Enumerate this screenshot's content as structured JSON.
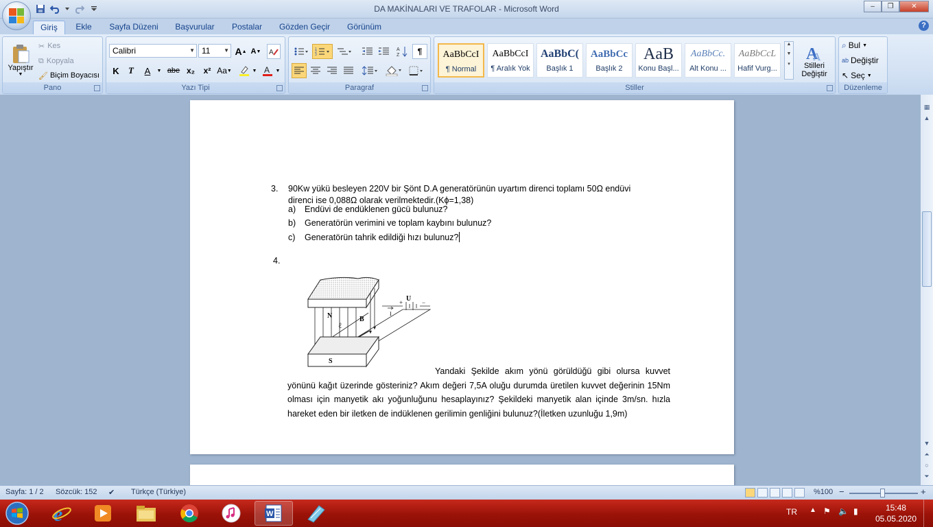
{
  "window": {
    "title": "DA MAKİNALARI VE TRAFOLAR - Microsoft Word",
    "controls": {
      "minimize": "–",
      "maximize": "❐",
      "close": "✕"
    }
  },
  "tabs": [
    "Giriş",
    "Ekle",
    "Sayfa Düzeni",
    "Başvurular",
    "Postalar",
    "Gözden Geçir",
    "Görünüm"
  ],
  "ribbon": {
    "clipboard": {
      "label": "Pano",
      "paste": "Yapıştır",
      "cut": "Kes",
      "copy": "Kopyala",
      "format_painter": "Biçim Boyacısı"
    },
    "font": {
      "label": "Yazı Tipi",
      "family": "Calibri",
      "size": "11",
      "bold": "K",
      "italic": "T",
      "underline": "A",
      "strike": "abe",
      "subscript": "x₂",
      "superscript": "x²",
      "change_case": "Aa",
      "grow": "A",
      "shrink": "A"
    },
    "paragraph": {
      "label": "Paragraf",
      "pilcrow": "¶"
    },
    "styles": {
      "label": "Stiller",
      "items": [
        {
          "sample": "AaBbCcI",
          "name": "¶ Normal"
        },
        {
          "sample": "AaBbCcI",
          "name": "¶ Aralık Yok"
        },
        {
          "sample": "AaBbC(",
          "name": "Başlık 1"
        },
        {
          "sample": "AaBbCc",
          "name": "Başlık 2"
        },
        {
          "sample": "AaB",
          "name": "Konu Başl..."
        },
        {
          "sample": "AaBbCc.",
          "name": "Alt Konu ..."
        },
        {
          "sample": "AaBbCcL",
          "name": "Hafif Vurg..."
        }
      ],
      "change_styles_line1": "Stilleri",
      "change_styles_line2": "Değiştir"
    },
    "editing": {
      "label": "Düzenleme",
      "find": "Bul",
      "replace": "Değiştir",
      "select": "Seç"
    }
  },
  "document": {
    "q3": {
      "number": "3.",
      "line1": "90Kw yükü besleyen 220V bir Şönt D.A generatörünün uyartım direnci toplamı 50Ω endüvi",
      "line2": "direnci ise 0,088Ω olarak verilmektedir.(Kϕ=1,38)",
      "items": [
        {
          "mark": "a)",
          "text": "Endüvi de endüklenen gücü bulunuz?"
        },
        {
          "mark": "b)",
          "text": "Generatörün verimini ve toplam kaybını bulunuz?"
        },
        {
          "mark": "c)",
          "text": "Generatörün tahrik edildiği hızı bulunuz?"
        }
      ]
    },
    "q4": {
      "number": "4.",
      "figure_labels": {
        "n": "N",
        "s": "S",
        "b": "B",
        "l": "ℓ",
        "u": "U",
        "i": "I",
        "plus": "+",
        "minus": "−"
      },
      "paragraph": "Yandaki Şekilde akım yönü görüldüğü gibi olursa kuvvet yönünü kağıt üzerinde gösteriniz? Akım değeri 7,5A oluğu durumda üretilen kuvvet değerinin 15Nm olması için manyetik akı yoğunluğunu hesaplayınız? Şekildeki manyetik alan içinde 3m/sn. hızla hareket eden bir iletken de indüklenen gerilimin genliğini bulunuz?(İletken uzunluğu 1,9m)"
    }
  },
  "statusbar": {
    "page": "Sayfa: 1 / 2",
    "words": "Sözcük: 152",
    "language": "Türkçe (Türkiye)",
    "zoom": "%100",
    "zoom_minus": "−",
    "zoom_plus": "+"
  },
  "taskbar": {
    "apps": [
      "internet-explorer-icon",
      "media-player-icon",
      "file-explorer-icon",
      "chrome-icon",
      "itunes-icon",
      "word-icon",
      "note-icon"
    ],
    "lang": "TR",
    "time": "15:48",
    "date": "05.05.2020"
  }
}
